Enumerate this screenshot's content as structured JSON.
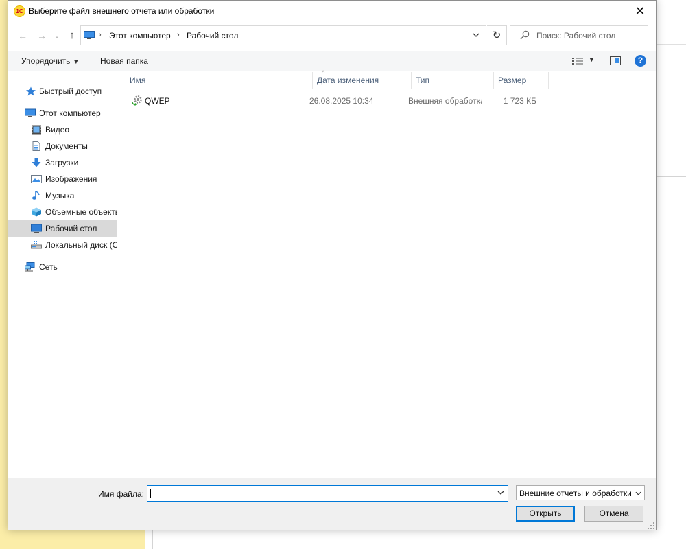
{
  "dialog": {
    "title": "Выберите файл внешнего отчета или обработки",
    "app_icon_text": "1С",
    "close_glyph": "✕"
  },
  "navigation": {
    "back_glyph": "←",
    "forward_glyph": "→",
    "recent_glyph": "⌄",
    "up_glyph": "↑",
    "address": {
      "crumbs": [
        "Этот компьютер",
        "Рабочий стол"
      ],
      "separator": "›"
    },
    "refresh_glyph": "↻",
    "search_placeholder": "Поиск: Рабочий стол"
  },
  "toolbar": {
    "organize_label": "Упорядочить",
    "new_folder_label": "Новая папка",
    "help_glyph": "?"
  },
  "nav_pane": {
    "items": [
      {
        "label": "Быстрый доступ",
        "icon": "star-icon"
      },
      {
        "label": "Этот компьютер",
        "icon": "computer-icon"
      },
      {
        "label": "Видео",
        "icon": "video-icon"
      },
      {
        "label": "Документы",
        "icon": "document-icon"
      },
      {
        "label": "Загрузки",
        "icon": "download-icon"
      },
      {
        "label": "Изображения",
        "icon": "image-icon"
      },
      {
        "label": "Музыка",
        "icon": "music-icon"
      },
      {
        "label": "Объемные объекты",
        "icon": "cube-icon"
      },
      {
        "label": "Рабочий стол",
        "icon": "desktop-icon"
      },
      {
        "label": "Локальный диск (C:)",
        "icon": "drive-icon"
      },
      {
        "label": "Сеть",
        "icon": "network-icon"
      }
    ],
    "selected_index": 8
  },
  "file_list": {
    "columns": [
      "Имя",
      "Дата изменения",
      "Тип",
      "Размер"
    ],
    "sort_glyph": "^",
    "rows": [
      {
        "name": "QWEP",
        "date": "26.08.2025 10:34",
        "type": "Внешняя обработка",
        "size": "1 723 КБ"
      }
    ]
  },
  "footer": {
    "file_name_label": "Имя файла:",
    "file_name_value": "",
    "filter_value": "Внешние отчеты и обработки",
    "open_label": "Открыть",
    "cancel_label": "Отмена"
  },
  "colors": {
    "accent": "#0078d7",
    "background_app": "#fbeda8",
    "selected_nav": "#d9d9d9",
    "header_text": "#4c607a"
  }
}
